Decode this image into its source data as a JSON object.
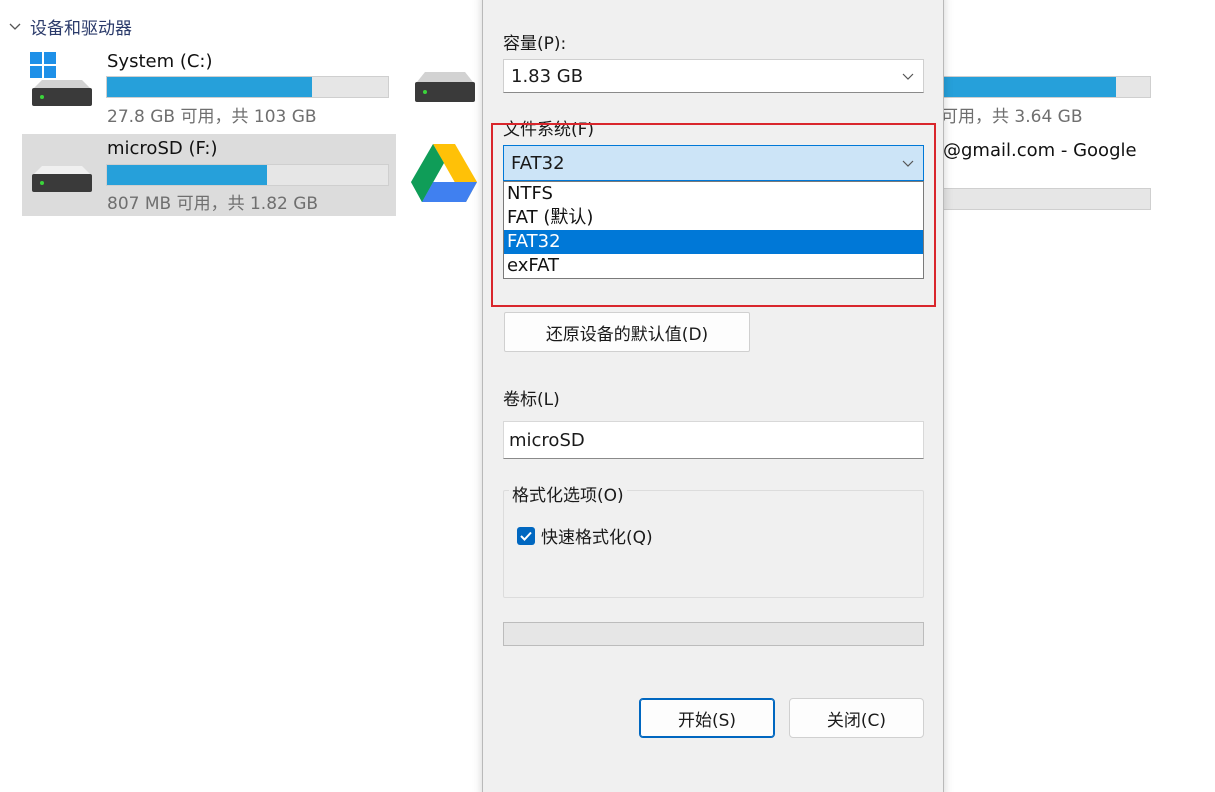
{
  "explorer": {
    "section_title": "设备和驱动器",
    "drives": [
      {
        "name": "System (C:)",
        "info": "27.8 GB 可用，共 103 GB",
        "used_fraction": 0.73
      },
      {
        "name": "microSD (F:)",
        "info": "807 MB 可用，共 1.82 GB",
        "used_fraction": 0.57
      },
      {
        "name": "",
        "info": "可用，共 3.64 GB",
        "used_fraction": 0.85
      },
      {
        "name": "@gmail.com - Google",
        "info": "",
        "used_fraction": 0.08
      }
    ]
  },
  "dialog": {
    "capacity_label": "容量(P):",
    "capacity_value": "1.83 GB",
    "filesystem_label": "文件系统(F)",
    "filesystem_value": "FAT32",
    "filesystem_options": [
      "NTFS",
      "FAT (默认)",
      "FAT32",
      "exFAT"
    ],
    "filesystem_selected_index": 2,
    "restore_defaults_button": "还原设备的默认值(D)",
    "volume_label_label": "卷标(L)",
    "volume_label_value": "microSD",
    "format_options_legend": "格式化选项(O)",
    "quick_format_label": "快速格式化(Q)",
    "quick_format_checked": true,
    "progress": 0,
    "start_button": "开始(S)",
    "close_button": "关闭(C)"
  },
  "colors": {
    "accent": "#0078d7",
    "bar_fill": "#26a0da",
    "highlight_border": "#d9262c"
  }
}
